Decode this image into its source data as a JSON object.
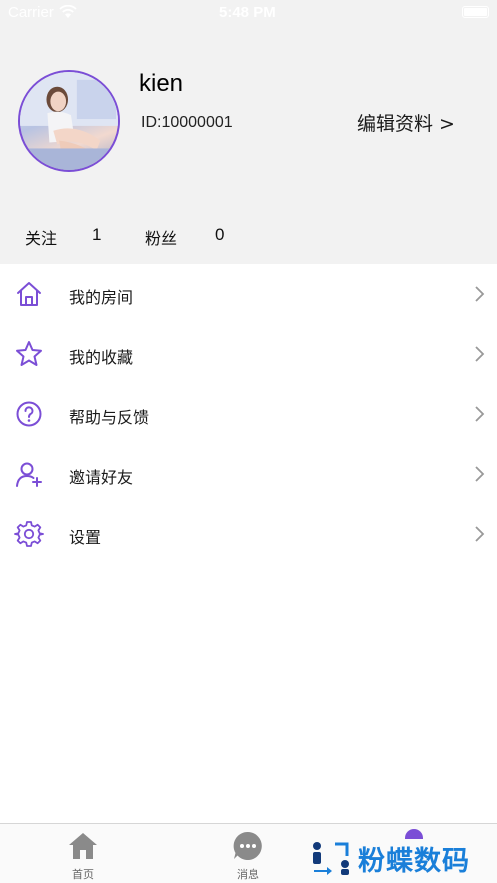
{
  "status_bar": {
    "carrier": "Carrier",
    "time": "5:48 PM"
  },
  "profile": {
    "username": "kien",
    "user_id": "ID:10000001",
    "edit_label": "编辑资料 >"
  },
  "stats": {
    "following_label": "关注",
    "following_count": "1",
    "fans_label": "粉丝",
    "fans_count": "0"
  },
  "menu": [
    {
      "label": "我的房间",
      "icon": "home-icon"
    },
    {
      "label": "我的收藏",
      "icon": "star-icon"
    },
    {
      "label": "帮助与反馈",
      "icon": "help-icon"
    },
    {
      "label": "邀请好友",
      "icon": "add-user-icon"
    },
    {
      "label": "设置",
      "icon": "gear-icon"
    }
  ],
  "tabbar": {
    "home_label": "首页",
    "messages_label": "消息"
  },
  "watermark": {
    "text": "粉蝶数码"
  },
  "colors": {
    "accent": "#7b4ed6",
    "header_bg": "#f2f2f2",
    "watermark": "#1a7fd9",
    "tab_icon": "#8a8a8a"
  }
}
